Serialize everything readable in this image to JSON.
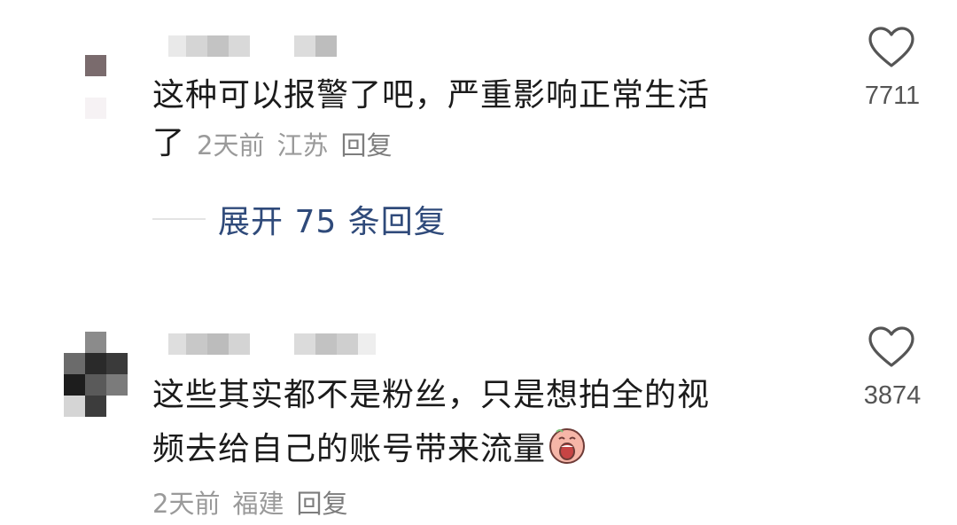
{
  "comments": [
    {
      "text_lines": [
        "这种可以报警了吧，严重影响正常生活",
        "了"
      ],
      "time": "2天前",
      "location": "江苏",
      "reply_label": "回复",
      "likes": "7711",
      "expand_label": "展开 75 条回复",
      "icons": [
        "heart-outline-icon"
      ]
    },
    {
      "text_lines": [
        "这些其实都不是粉丝，只是想拍全的视",
        "频去给自己的账号带来流量"
      ],
      "time": "2天前",
      "location": "福建",
      "reply_label": "回复",
      "likes": "3874",
      "icons": [
        "heart-outline-icon",
        "crying-face-emoji"
      ]
    }
  ],
  "colors": {
    "text": "#1b1b1b",
    "meta": "#9a9a9a",
    "link": "#2f4a7a",
    "like": "#555555"
  }
}
